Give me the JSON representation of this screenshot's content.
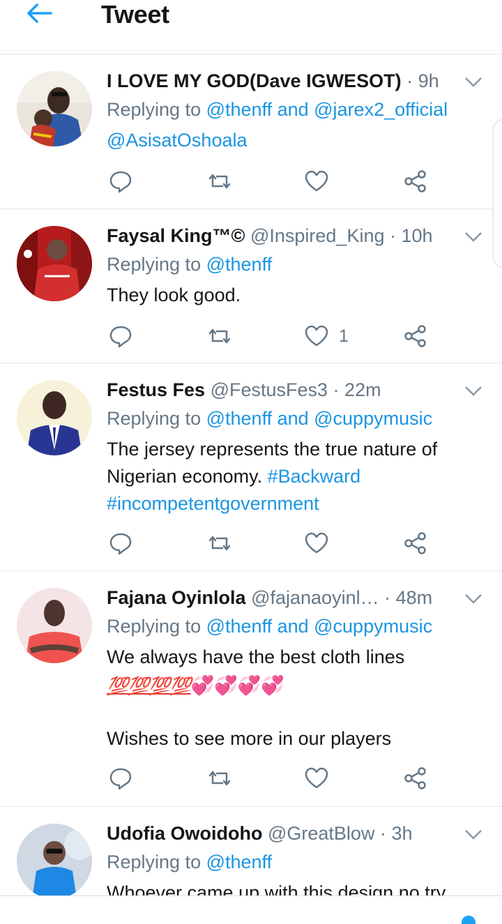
{
  "header": {
    "title": "Tweet",
    "back_icon": "arrow-left-icon",
    "accent_color": "#1da1f2"
  },
  "tweets": [
    {
      "name": "I LOVE MY GOD(Dave IGWESOT)",
      "handle": "",
      "time": "9h",
      "replying_prefix": "Replying to",
      "reply_line1": "@thenff and @jarex2_official",
      "reply_line2": "@AsisatOshoala",
      "text": [],
      "like_count": ""
    },
    {
      "name": "Faysal King™©",
      "handle": "@Inspired_King",
      "time": "10h",
      "replying_prefix": "Replying to",
      "reply_line1": "@thenff",
      "text": [
        "They look good."
      ],
      "like_count": "1"
    },
    {
      "name": "Festus Fes",
      "handle": "@FestusFes3",
      "time": "22m",
      "replying_prefix": "Replying to",
      "reply_line1": "@thenff and @cuppymusic",
      "text": [
        "The jersey represents the true nature of",
        "Nigerian economy."
      ],
      "hashtag1": "#Backward",
      "hashtag2": "#incompetentgovernment",
      "like_count": ""
    },
    {
      "name": "Fajana Oyinlola",
      "handle": "@fajanaoyinl…",
      "time": "48m",
      "replying_prefix": "Replying to",
      "reply_line1": "@thenff and @cuppymusic",
      "text": [
        "We always have the best cloth lines",
        "Wishes to see more in our players"
      ],
      "emoji_100": "💯💯💯💯",
      "emoji_hearts": "💞💞💞💞",
      "like_count": ""
    },
    {
      "name": "Udofia Owoidoho",
      "handle": "@GreatBlow",
      "time": "3h",
      "replying_prefix": "Replying to",
      "reply_line1": "@thenff",
      "text": [
        "Whoever came up with this design no try"
      ],
      "like_count": ""
    }
  ],
  "colors": {
    "link": "#1b95e0",
    "secondary_text": "#657786",
    "divider": "#e1e8ed"
  }
}
